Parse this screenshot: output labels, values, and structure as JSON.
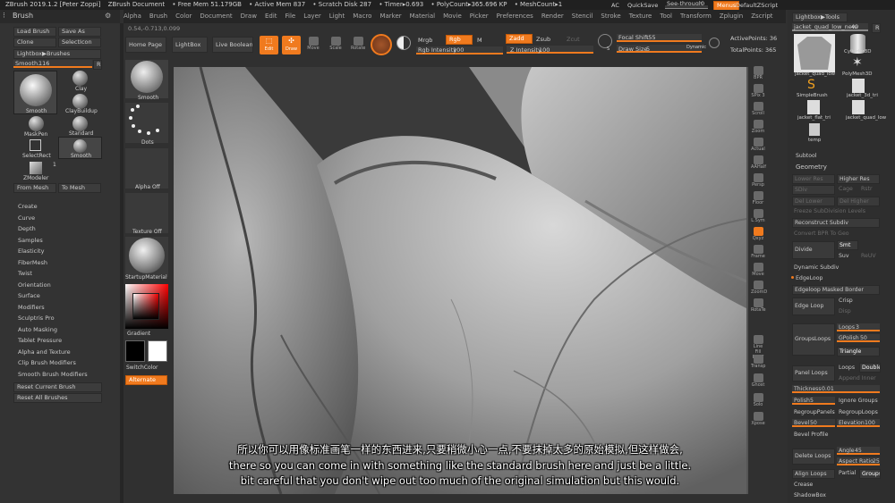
{
  "titlebar": {
    "app": "ZBrush 2019.1.2 [Peter Zoppi]",
    "doc": "ZBrush Document",
    "freemem": "• Free Mem 51.179GB",
    "activemem": "• Active Mem 837",
    "scratch": "• Scratch Disk 287",
    "timer": "• Timer▸0.693",
    "polycount": "• PolyCount▸365.696 KP",
    "meshcount": "• MeshCount▸1",
    "ac": "AC",
    "quicksave": "QuickSave",
    "seethrough": "See-through",
    "seethrough_val": "0",
    "menus": "Menus",
    "script": "DefaultZScript"
  },
  "menubar": [
    "Alpha",
    "Brush",
    "Color",
    "Document",
    "Draw",
    "Edit",
    "File",
    "Layer",
    "Light",
    "Macro",
    "Marker",
    "Material",
    "Movie",
    "Picker",
    "Preferences",
    "Render",
    "Stencil",
    "Stroke",
    "Texture",
    "Tool",
    "Transform",
    "Zplugin",
    "Zscript"
  ],
  "left": {
    "title": "Brush",
    "coords": "0.54,-0.713,0.099",
    "load": "Load Brush",
    "saveas": "Save As",
    "clone": "Clone",
    "selecticon": "SelectIcon",
    "lightbox": "Lightbox▶Brushes",
    "smooth_label": "Smooth.",
    "smooth_val": "116",
    "r": "R",
    "brushes": [
      "Smooth",
      "Clay",
      "ClayBuildup",
      "MaskPen",
      "Standard",
      "SelectRect",
      "Smooth",
      "ZModeler"
    ],
    "zmodeler_count": "1",
    "frommesh": "From Mesh",
    "tomesh": "To Mesh",
    "menu": [
      "Create",
      "Curve",
      "Depth",
      "Samples",
      "Elasticity",
      "FiberMesh",
      "Twist",
      "Orientation",
      "Surface",
      "Modifiers",
      "Sculptris Pro",
      "Auto Masking",
      "Tablet Pressure",
      "Alpha and Texture",
      "Clip Brush Modifiers",
      "Smooth Brush Modifiers"
    ],
    "reset_current": "Reset Current Brush",
    "reset_all": "Reset All Brushes"
  },
  "tray": {
    "smooth": "Smooth",
    "dots": "Dots",
    "alpha": "Alpha Off",
    "texture": "Texture Off",
    "material": "StartupMaterial",
    "gradient": "Gradient",
    "switchcolor": "SwitchColor",
    "alternate": "Alternate"
  },
  "topshelf": {
    "homepage": "Home Page",
    "lightbox": "LightBox",
    "liveboolean": "Live Boolean",
    "edit": "Edit",
    "draw": "Draw",
    "move": "Move",
    "scale": "Scale",
    "rotate": "Rotate",
    "mrgb": "Mrgb",
    "rgb": "Rgb",
    "m": "M",
    "rgbint_label": "Rgb Intensity",
    "rgbint_val": "100",
    "zadd": "Zadd",
    "zsub": "Zsub",
    "zcut": "Zcut",
    "zint_label": "Z Intensity",
    "zint_val": "100",
    "focal_label": "Focal Shift",
    "focal_val": "-55",
    "drawsize_label": "Draw Size",
    "drawsize_val": "5",
    "dynamic": "Dynamic",
    "activepoints": "ActivePoints: 36",
    "totalpoints": "TotalPoints: 365"
  },
  "rightshelf": [
    "BPR",
    "SPix 3",
    "Scroll",
    "Zoom",
    "Actual",
    "AAHalf",
    "Persp",
    "Floor",
    "L.Sym",
    "Qxyz",
    "Frame",
    "Move",
    "ZoomD",
    "RotaTe",
    "Line Fill PolyF",
    "Transp",
    "Ghost",
    "Solo",
    "Xpose"
  ],
  "right": {
    "lightbox": "Lightbox▶Tools",
    "toolname": "jacket_quad_low_new.",
    "toolnum": "49",
    "r": "R",
    "tools": [
      "jacket_quad_low",
      "Cylinder3D",
      "PolyMesh3D",
      "SimpleBrush",
      "jacket_3d_tri",
      "jacket_flat_tri",
      "jacket_quad_low",
      "temp"
    ],
    "subtool": "Subtool",
    "geometry": "Geometry",
    "lowerres": "Lower Res",
    "higherres": "Higher Res",
    "sdiv": "SDiv",
    "cage": "Cage",
    "rstr": "Rstr",
    "dellower": "Del Lower",
    "delhigher": "Del Higher",
    "freeze": "Freeze SubDivision Levels",
    "reconstruct": "Reconstruct Subdiv",
    "convertbpr": "Convert BPR To Geo",
    "divide": "Divide",
    "smt": "Smt",
    "suv": "Suv",
    "reuv": "ReUV",
    "dynsubdiv": "Dynamic Subdiv",
    "edgeloop": "EdgeLoop",
    "edgeloopmasked": "Edgeloop Masked Border",
    "edgeloopbtn": "Edge Loop",
    "crisp": "Crisp",
    "disp": "Disp",
    "loops": "Loops",
    "loops_val": "3",
    "gpolish": "GPolish",
    "gpolish_val": "50",
    "groupsloops": "GroupsLoops",
    "triangle": "Triangle",
    "panelloops": "Panel Loops",
    "loops2": "Loops",
    "double": "Double",
    "append": "Append Inner",
    "thickness": "Thickness",
    "thickness_val": "0.01",
    "polish": "Polish",
    "polish_val": "5",
    "ignoregroups": "Ignore Groups",
    "regrouppanels": "RegroupPanels",
    "regrouploops": "RegroupLoops",
    "bevel": "Bevel",
    "bevel_val": "50",
    "elevation": "Elevation",
    "elevation_val": "100",
    "bevelprofile": "Bevel Profile",
    "deleteloops": "Delete Loops",
    "angle": "Angle",
    "angle_val": "45",
    "aspect": "Aspect Ratio",
    "aspect_val": "25",
    "alignloops": "Align Loops",
    "partial": "Partial",
    "groups": "Groups",
    "crease": "Crease",
    "shadowbox": "ShadowBox"
  },
  "subtitles": {
    "zh": "所以你可以用像标准画笔一样的东西进来,只要稍微小心一点,不要抹掉太多的原始模拟,但这样做会,",
    "en1": "there so you can come in with something like the standard brush here and just be a little.",
    "en2": "bit careful that you don't wipe out too much of the original simulation but this would."
  },
  "colors": {
    "accent": "#f07a1e"
  }
}
